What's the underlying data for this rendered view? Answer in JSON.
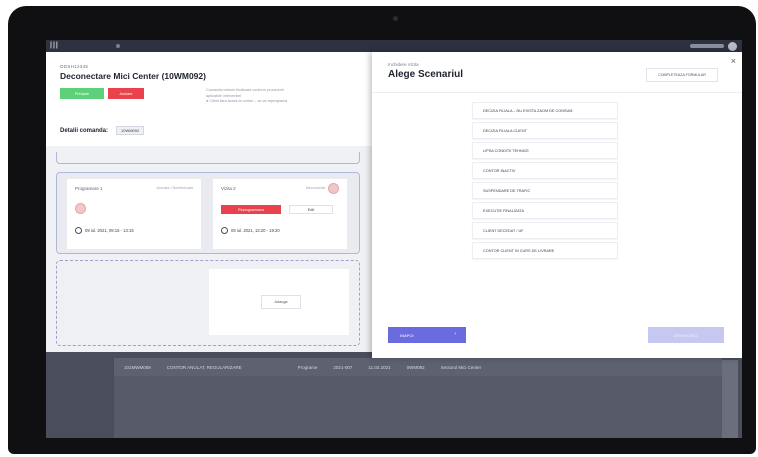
{
  "device": {
    "type": "laptop"
  },
  "app": {
    "logo": "|||",
    "colors": {
      "accent": "#6b6be0",
      "danger": "#e9424c",
      "success": "#5fd07a"
    }
  },
  "order": {
    "tag": "ODSH12345",
    "title": "Deconectare Mici Center (10WM092)",
    "primary_button": "Preluare",
    "secondary_button": "Anulare",
    "note_line1": "Comanda trebuie finalizata conform procedurii",
    "note_line2": "aplicabile interventiei",
    "note_line3": "● Client fara acces la contor – se va reprograma",
    "details_label": "Detalii comanda:",
    "details_value": "10WM092"
  },
  "appointments": [
    {
      "name": "Programare 1",
      "status": "Anulata / Neefectuata",
      "time": "09 iul. 2021, 09:15 - 13:15"
    },
    {
      "name": "Vizita 2",
      "status": "Neconectat",
      "time": "09 iul. 2021, 13:20 - 19:20",
      "action_primary": "Reprogrameaza",
      "action_secondary": "Edit"
    }
  ],
  "empty_slot_button": "Adauga",
  "background_table": {
    "row": [
      "101MWM089",
      "CONTOR ANULAT, REGULARIZARE",
      "Programe",
      "2021-007",
      "11.02.2021",
      "0WM092",
      "Sectorul Mici Center"
    ]
  },
  "modal": {
    "step": "Inchidere Vizita",
    "title": "Alege Scenariul",
    "complete_button": "COMPLETEAZA FORMULAR",
    "close_icon": "×",
    "scenarios": [
      "DECIZIA FILIALA – NU EXISTA ZAOM DE CONSUM",
      "DECIZIA FILIALA CLIENT",
      "LIPSA CONDITII TEHNICE",
      "CONTOR INACTIV",
      "SUSPENDARE DE TRAFIC",
      "EXECUTIE FINALIZATA",
      "CLIENT DECEDAT / UF",
      "CONTOR CLIENT IN CURS DE LIVRARE"
    ],
    "back_button": "INAPOI",
    "next_button": "URMATORUL"
  }
}
